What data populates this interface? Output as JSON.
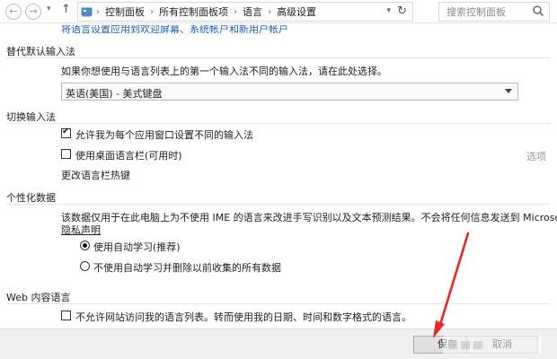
{
  "address_bar": {
    "back_glyph": "←",
    "forward_glyph": "→",
    "up_glyph": "↑",
    "icon": "control-panel-icon",
    "breadcrumbs": [
      "控制面板",
      "所有控制面板项",
      "语言",
      "高级设置"
    ],
    "search_placeholder": "搜索控制面板"
  },
  "top_link": "将语言设置应用到欢迎屏幕、系统帐户和新用户帐户",
  "sections": {
    "input_method": {
      "title": "替代默认输入法",
      "description": "如果你想使用与语言列表上的第一个输入法不同的输入法，请在此处选择。",
      "selected": "英语(美国) - 美式键盘"
    },
    "switch_input": {
      "title": "切换输入法",
      "checkbox1_label": "允许我为每个应用窗口设置不同的输入法",
      "checkbox1_checked": true,
      "checkbox2_label": "使用桌面语言栏(可用时)",
      "checkbox2_checked": false,
      "options_link": "选项",
      "hotkeys_link": "更改语言栏热键"
    },
    "personalization": {
      "title": "个性化数据",
      "description": "该数据仅用于在此电脑上为不使用 IME 的语言来改进手写识别以及文本预测结果。不会将任何信息发送到 Microsoft。",
      "privacy_link": "隐私声明",
      "radio1_label": "使用自动学习(推荐)",
      "radio1_selected": true,
      "radio2_label": "不使用自动学习并删除以前收集的所有数据",
      "radio2_selected": false
    },
    "web_content": {
      "title": "Web 内容语言",
      "checkbox_label": "不允许网站访问我的语言列表。转而使用我的日期、时间和数字格式的语言。",
      "checkbox_checked": false
    }
  },
  "buttons": {
    "save": "保存",
    "cancel": "取消"
  },
  "colors": {
    "link": "#1a5fb4",
    "annotation_arrow": "#e8262a",
    "bottom_bar": "#f0f0f0"
  }
}
